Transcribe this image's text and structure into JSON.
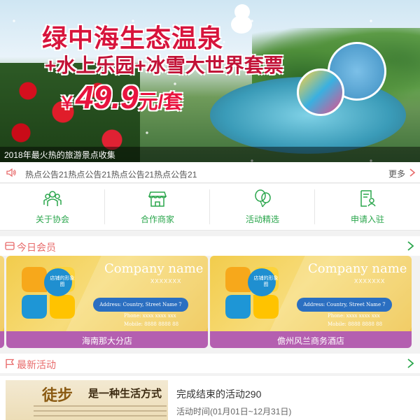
{
  "banner": {
    "title_line1": "绿中海生态温泉",
    "title_line2": "+水上乐园+冰雪大世界套票",
    "price_currency": "￥",
    "price_value": "49.9",
    "price_unit": "元/套",
    "caption": "2018年最火热的旅游景点收集"
  },
  "notice": {
    "text": "热点公告21热点公告21热点公告21热点公告21",
    "more_label": "更多"
  },
  "quicknav": {
    "items": [
      {
        "label": "关于协会",
        "icon": "people-icon"
      },
      {
        "label": "合作商家",
        "icon": "store-icon"
      },
      {
        "label": "活动精选",
        "icon": "balloon-icon"
      },
      {
        "label": "申请入驻",
        "icon": "apply-document-icon"
      }
    ]
  },
  "members_section": {
    "title": "今日会员",
    "cards": [
      {
        "name": "海南那大分店",
        "company": "Company name",
        "sub": "XXXXXXX",
        "logo_text": "店铺的形象图",
        "address": "Address: Country, Street Name 7",
        "phone": "Phone: xxxx xxxx xxx",
        "mobile": "Mobile: 8888 8888 88"
      },
      {
        "name": "儋州风兰商务酒店",
        "company": "Company name",
        "sub": "XXXXXXX",
        "logo_text": "店铺的形象图",
        "address": "Address: Country, Street Name 7",
        "phone": "Phone: xxxx xxxx xxx",
        "mobile": "Mobile: 8888 8888 88"
      }
    ]
  },
  "activity_section": {
    "title": "最新活动",
    "items": [
      {
        "thumb_text1": "徒步",
        "thumb_text2": "是一种生活方式",
        "title": "完成结束的活动290",
        "time": "活动时间(01月01日~12月31日)"
      }
    ]
  },
  "colors": {
    "green": "#2aa64c",
    "section_title": "#e86b6b",
    "member_name_bar": "#b45fb0",
    "card_yellow": "#f2cc4c"
  }
}
